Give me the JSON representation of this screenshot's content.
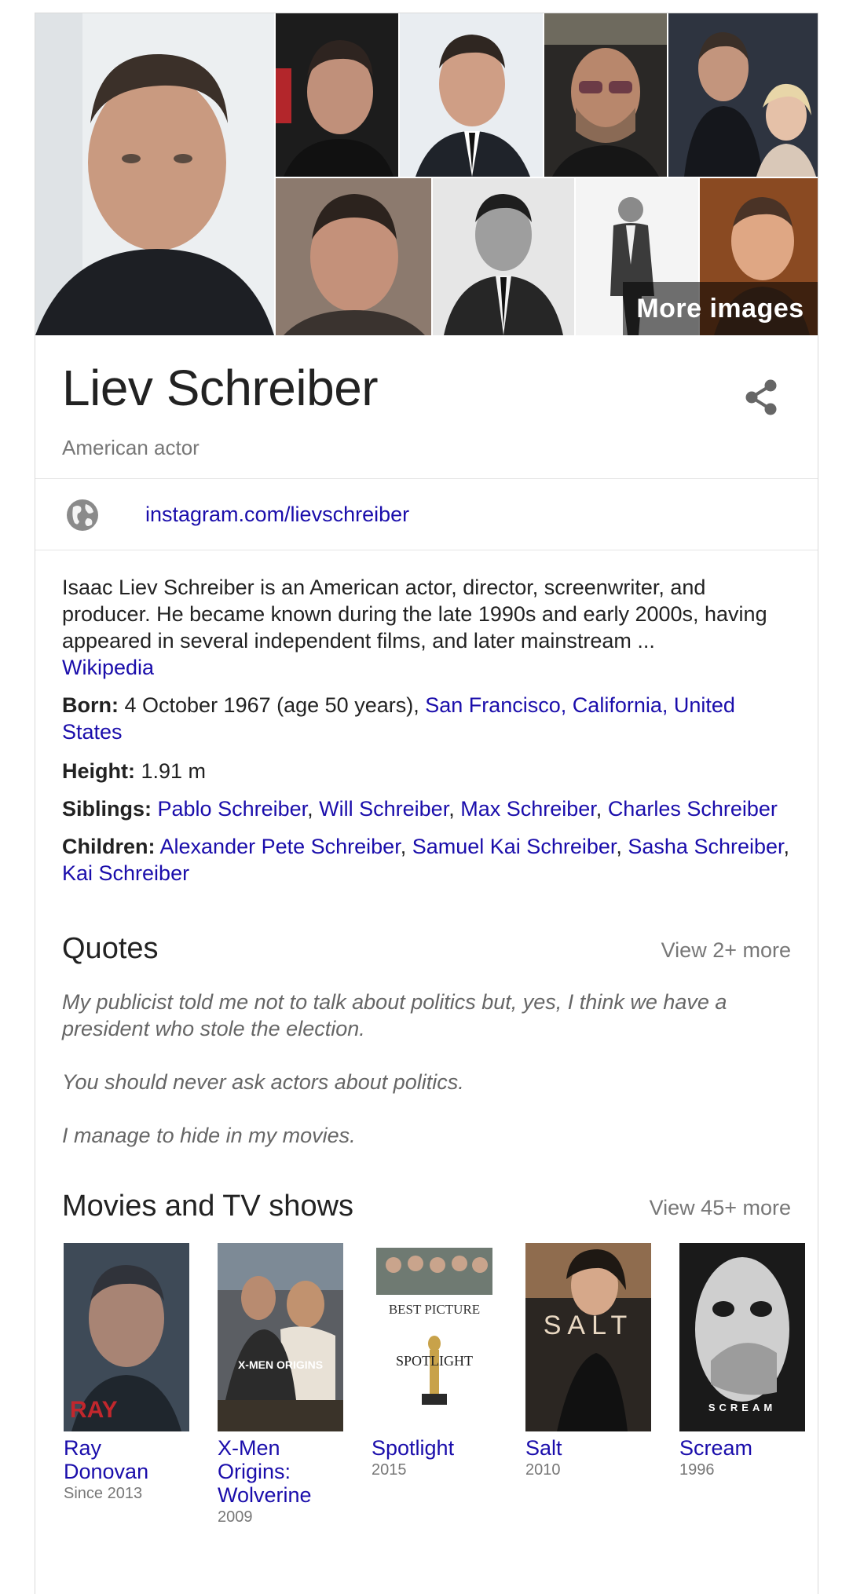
{
  "mosaic": {
    "more_images_label": "More images"
  },
  "entity": {
    "name": "Liev Schreiber",
    "subtitle": "American actor",
    "website": "instagram.com/lievschreiber"
  },
  "description": {
    "text": "Isaac Liev Schreiber is an American actor, director, screenwriter, and producer. He became known during the late 1990s and early 2000s, having appeared in several independent films, and later mainstream ...",
    "source": "Wikipedia"
  },
  "facts": {
    "born": {
      "label": "Born:",
      "value": "4 October 1967 (age 50 years),",
      "place": "San Francisco, California, United States"
    },
    "height": {
      "label": "Height:",
      "value": "1.91 m"
    },
    "siblings": {
      "label": "Siblings:",
      "items": [
        "Pablo Schreiber",
        "Will Schreiber",
        "Max Schreiber",
        "Charles Schreiber"
      ]
    },
    "children": {
      "label": "Children:",
      "items": [
        "Alexander Pete Schreiber",
        "Samuel Kai Schreiber",
        "Sasha Schreiber",
        "Kai Schreiber"
      ]
    }
  },
  "quotes": {
    "title": "Quotes",
    "view_more": "View 2+ more",
    "items": [
      "My publicist told me not to talk about politics but, yes, I think we have a president who stole the election.",
      "You should never ask actors about politics.",
      "I manage to hide in my movies."
    ]
  },
  "movies": {
    "title": "Movies and TV shows",
    "view_more": "View 45+ more",
    "items": [
      {
        "title": "Ray Donovan",
        "year": "Since 2013",
        "poster_text": "RAY"
      },
      {
        "title": "X-Men Origins: Wolverine",
        "year": "2009",
        "poster_text": "X-MEN ORIGINS"
      },
      {
        "title": "Spotlight",
        "year": "2015",
        "poster_text": "SPOTLIGHT"
      },
      {
        "title": "Salt",
        "year": "2010",
        "poster_text": "SALT"
      },
      {
        "title": "Scream",
        "year": "1996",
        "poster_text": "SCREAM"
      }
    ]
  },
  "colors": {
    "link": "#1a0dab",
    "muted": "#777777",
    "divider": "#e6e6e6"
  }
}
